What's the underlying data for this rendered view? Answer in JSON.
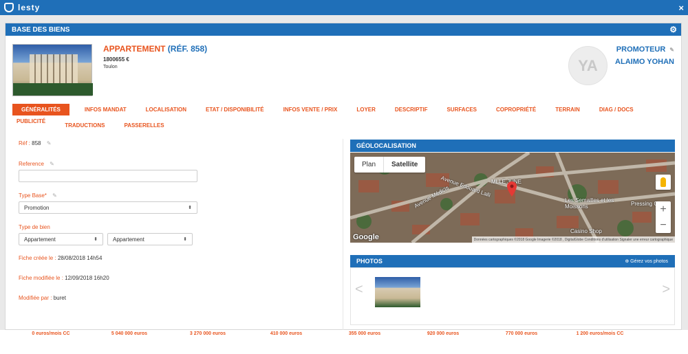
{
  "topbar": {
    "app_name": "lesty",
    "close_label": "×"
  },
  "panel": {
    "title": "BASE DES BIENS"
  },
  "property": {
    "type": "APPARTEMENT",
    "ref": "(RÉF. 858)",
    "price": "1800655 €",
    "city": "Toulon"
  },
  "contact": {
    "initials": "YA",
    "role": "PROMOTEUR",
    "name": "ALAIMO YOHAN"
  },
  "tabs": [
    "GÉNÉRALITÉS",
    "INFOS MANDAT",
    "LOCALISATION",
    "ETAT / DISPONIBILITÉ",
    "INFOS VENTE / PRIX",
    "LOYER",
    "DESCRIPTIF",
    "SURFACES",
    "COPROPRIÉTÉ",
    "TERRAIN",
    "DIAG / DOCS",
    "PUBLICITÉ",
    "TRADUCTIONS",
    "PASSERELLES"
  ],
  "form": {
    "ref_label": "Réf :",
    "ref_value": "858",
    "reference_label": "Reference",
    "reference_value": "",
    "type_base_label": "Type Base*",
    "type_base_value": "Promotion",
    "type_bien_label": "Type de bien",
    "type_bien_value_1": "Appartement",
    "type_bien_value_2": "Appartement",
    "created_label": "Fiche créée le :",
    "created_value": "28/08/2018 14h54",
    "modified_label": "Fiche modifiée le :",
    "modified_value": "12/09/2018 16h20",
    "modified_by_label": "Modifiée par :",
    "modified_by_value": "buret"
  },
  "geo": {
    "title": "GÉOLOCALISATION",
    "map_btn_plan": "Plan",
    "map_btn_satellite": "Satellite",
    "zoom_in": "+",
    "zoom_out": "−",
    "labels": [
      "Avenue Médicis",
      "Avenue Edouard Lalli",
      "Les Semailles et les Moissons",
      "Casino Shop",
      "Pressing C",
      "MLLE JUNE"
    ],
    "google_word": "Google",
    "attribution": "Données cartographiques ©2018 Google Imagerie ©2018 , DigitalGlobe   Conditions d'utilisation   Signaler une erreur cartographique"
  },
  "photos": {
    "title": "PHOTOS",
    "manage": "Gérez vos photos",
    "prev": "<",
    "next": ">"
  },
  "footer_values": [
    "0 euros/mois CC",
    "5 040 000 euros",
    "3 270 000 euros",
    "410 000 euros",
    "355 000 euros",
    "920 000 euros",
    "770 000 euros",
    "1 200 euros/mois CC"
  ],
  "colors": {
    "brand_blue": "#1f6fb8",
    "accent_orange": "#e8541e"
  }
}
